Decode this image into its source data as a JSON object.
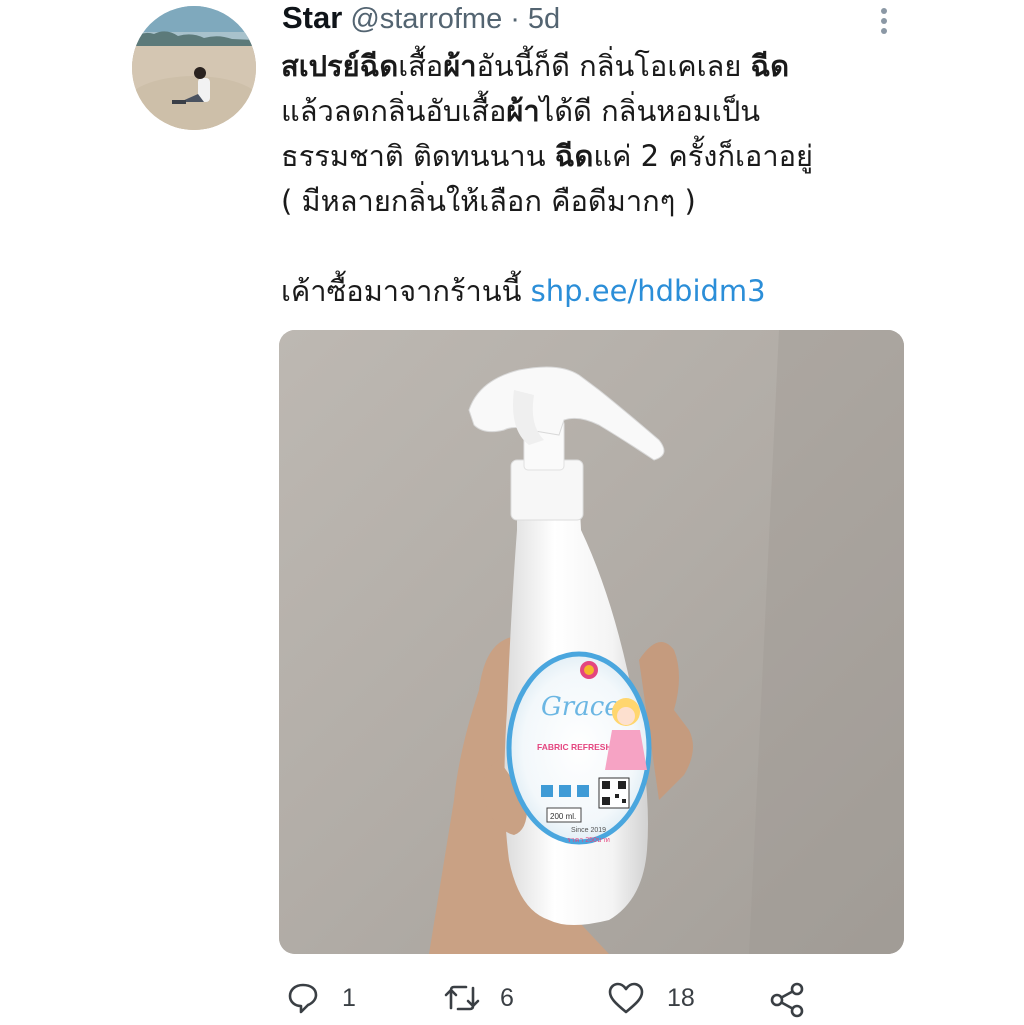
{
  "tweet": {
    "display_name": "Star",
    "handle": "@starrofme",
    "separator": "·",
    "time": "5d",
    "avatar": "profile-photo-beach",
    "lines": [
      [
        {
          "t": "สเปรย์ฉีด",
          "b": true
        },
        {
          "t": "เสื้อ",
          "b": false
        },
        {
          "t": "ผ้า",
          "b": true
        },
        {
          "t": "อันนี้ก็ดี กลิ่นโอเคเลย ",
          "b": false
        },
        {
          "t": "ฉีด",
          "b": true
        }
      ],
      [
        {
          "t": "แล้วลดกลิ่นอับเสื้อ",
          "b": false
        },
        {
          "t": "ผ้า",
          "b": true
        },
        {
          "t": "ได้ดี กลิ่นหอมเป็น",
          "b": false
        }
      ],
      [
        {
          "t": "ธรรมชาติ ติดทนนาน ",
          "b": false
        },
        {
          "t": "ฉีด",
          "b": true
        },
        {
          "t": "แค่ 2 ครั้งก็เอาอยู่",
          "b": false
        }
      ],
      [
        {
          "t": "( มีหลายกลิ่นให้เลือก คือดีมากๆ )",
          "b": false
        }
      ],
      [],
      [
        {
          "t": "เค้าซื้อมาจากร้านนี้ ",
          "b": false
        },
        {
          "t": "shp.ee/hdbidm3",
          "link": true
        }
      ]
    ],
    "media": {
      "description_icon": "photo-hand-holding-spray-bottle",
      "label_brand": "Grace",
      "label_product": "FABRIC REFRESHER",
      "label_volume": "200 ml.",
      "label_since": "Since 2019",
      "label_price": "ราคา 250บาท"
    }
  },
  "actions": {
    "reply_count": "1",
    "retweet_count": "6",
    "like_count": "18"
  },
  "colors": {
    "link": "#2b8ed8",
    "secondary_text": "#536471",
    "label_ring": "#4aa6de",
    "label_pink": "#e4457f"
  }
}
